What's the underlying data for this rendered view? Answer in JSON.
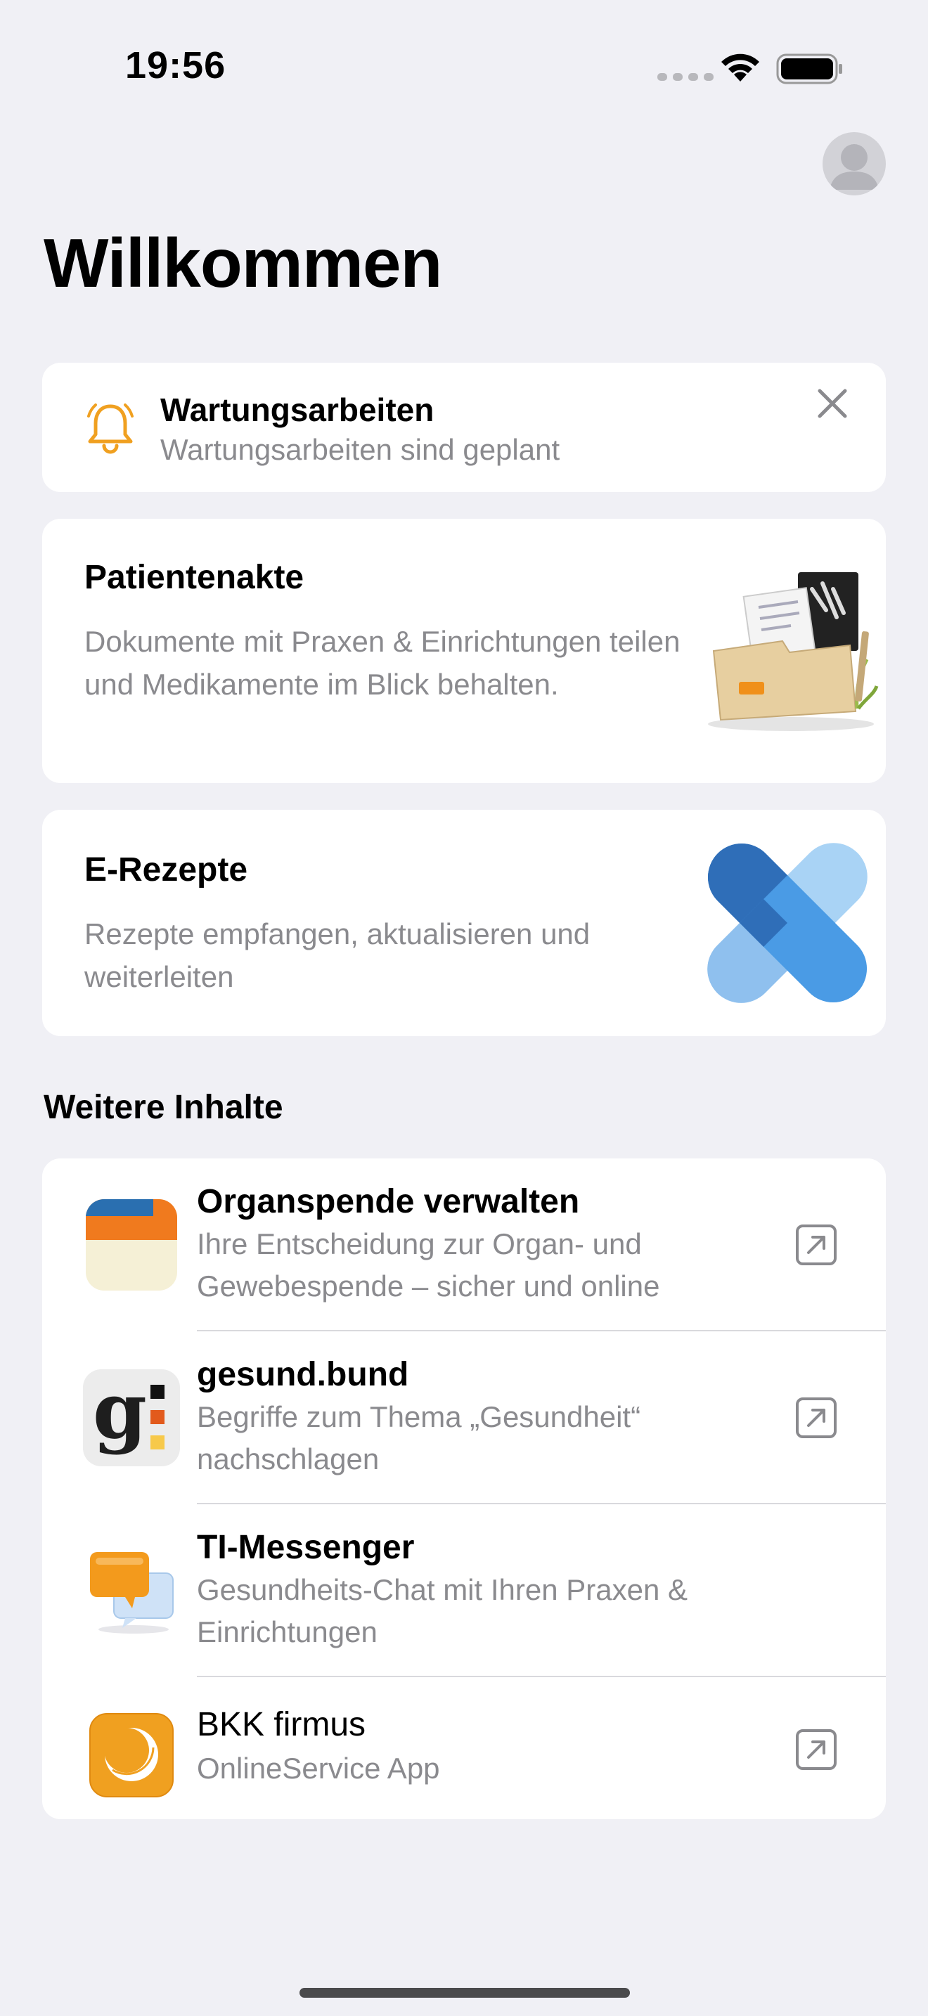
{
  "status_bar": {
    "time": "19:56"
  },
  "header": {
    "title": "Willkommen"
  },
  "notice": {
    "title": "Wartungsarbeiten",
    "subtitle": "Wartungsarbeiten sind geplant"
  },
  "features": {
    "patient_record": {
      "title": "Patientenakte",
      "description": "Dokumente mit Praxen & Einrichtungen teilen und Medikamente im Blick behalten."
    },
    "prescriptions": {
      "title": "E-Rezepte",
      "description": "Rezepte empfangen, aktualisieren und weiterleiten"
    }
  },
  "more_content": {
    "section_title": "Weitere Inhalte",
    "items": [
      {
        "title": "Organspende verwalten",
        "subtitle": "Ihre Entscheidung zur Organ- und Gewebespende – sicher und online",
        "icon": "organ-donation-icon",
        "external": true
      },
      {
        "title": "gesund.bund",
        "subtitle": "Begriffe zum Thema „Gesundheit“ nachschlagen",
        "icon": "gesund-bund-icon",
        "icon_letter": "g",
        "external": true
      },
      {
        "title": "TI-Messenger",
        "subtitle": "Gesundheits-Chat mit Ihren Praxen & Einrichtungen",
        "icon": "messenger-icon",
        "external": false
      },
      {
        "title": "BKK firmus",
        "subtitle": "OnlineService App",
        "icon": "bkk-firmus-icon",
        "external": true
      }
    ]
  },
  "colors": {
    "background": "#f0f0f5",
    "accent_orange": "#f0a020",
    "plaster_light": "#a9d3f5",
    "plaster_mid": "#4a9be5",
    "plaster_dark": "#2f6eb8"
  }
}
